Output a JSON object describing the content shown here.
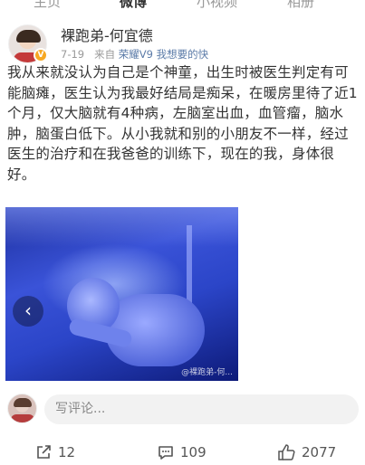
{
  "tabs": [
    {
      "label": "主页",
      "active": false
    },
    {
      "label": "微博",
      "active": true
    },
    {
      "label": "小视频",
      "active": false
    },
    {
      "label": "相册",
      "active": false
    }
  ],
  "post": {
    "username": "裸跑弟-何宜德",
    "date": "7-19",
    "source_prefix": "来自",
    "source": "荣耀V9 我想要的快",
    "text": "我从来就没认为自己是个神童，出生时被医生判定有可能脑瘫，医生认为我最好结局是痴呆，在暖房里待了近1个月，仅大脑就有4种病，左脑室出血，血管瘤，脑水肿，脑蛋白低下。从小我就和别的小朋友不一样，经过医生的治疗和在我爸爸的训练下，现在的我，身体很好。",
    "image_watermark": "@裸跑弟-何..."
  },
  "comment": {
    "placeholder": "写评论..."
  },
  "actions": {
    "reposts": "12",
    "comments": "109",
    "likes": "2077"
  },
  "icons": {
    "verified": "verified-badge-icon",
    "prev": "chevron-left-icon",
    "repost": "repost-icon",
    "comment": "comment-icon",
    "like": "thumbs-up-icon"
  },
  "colors": {
    "accent_orange": "#f7a823",
    "source_blue": "#5b7ba8",
    "text": "#333333",
    "muted": "#999999"
  }
}
